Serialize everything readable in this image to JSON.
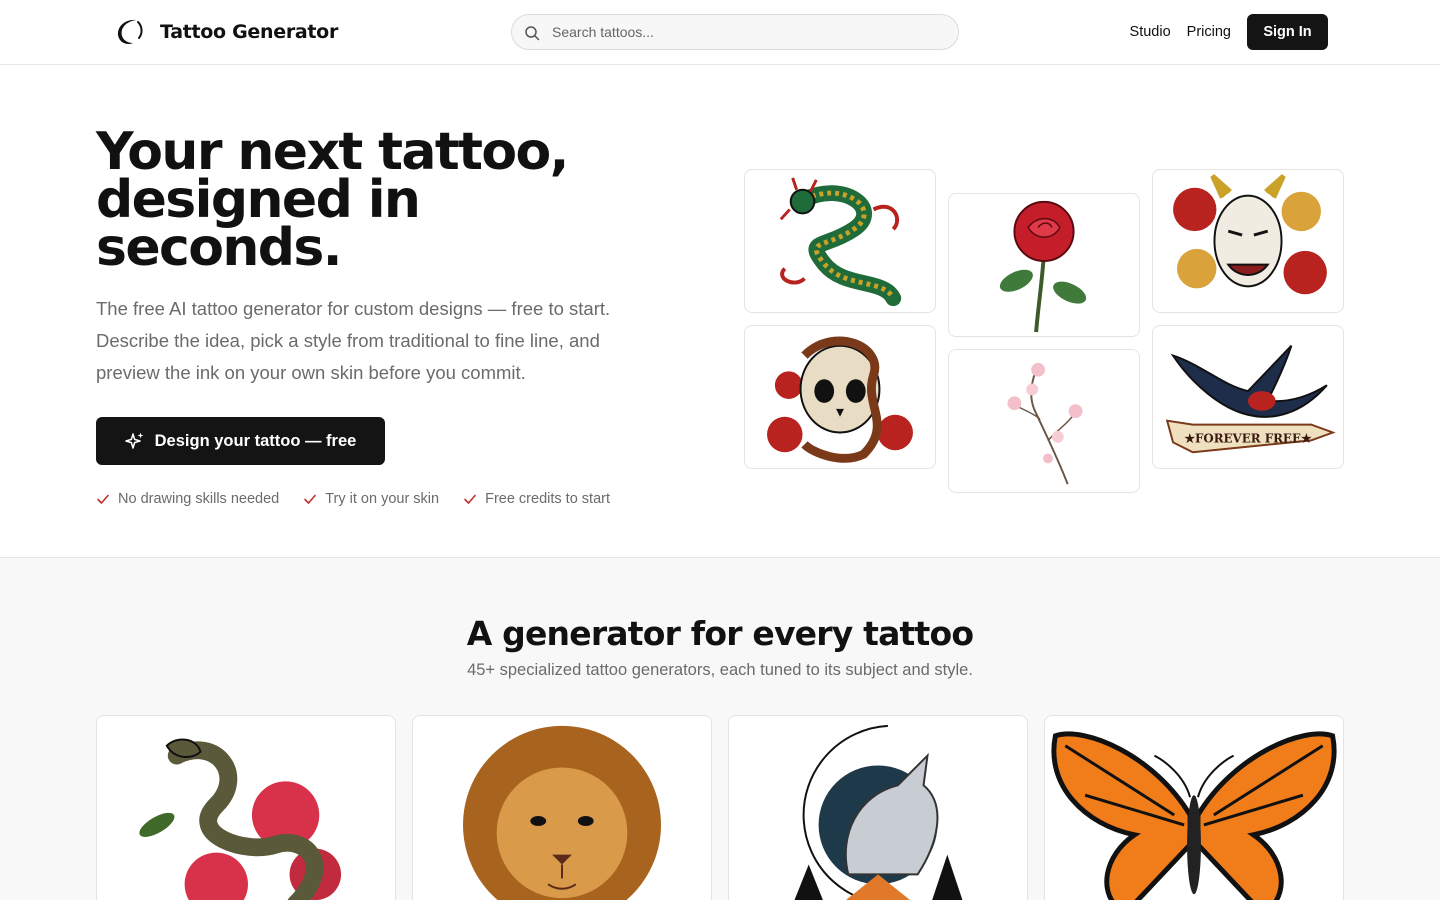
{
  "header": {
    "logo_text": "Tattoo Generator",
    "search_placeholder": "Search tattoos...",
    "nav": {
      "studio": "Studio",
      "pricing": "Pricing",
      "sign_in": "Sign In"
    }
  },
  "hero": {
    "title": "Your next tattoo, designed in seconds.",
    "description": "The free AI tattoo generator for custom designs — free to start. Describe the idea, pick a style from traditional to fine line, and preview the ink on your own skin before you commit.",
    "cta_label": "Design your tattoo — free",
    "checks": [
      "No drawing skills needed",
      "Try it on your skin",
      "Free credits to start"
    ],
    "gallery": [
      {
        "icon": "dragon-tattoo-image"
      },
      {
        "icon": "rose-tattoo-image"
      },
      {
        "icon": "hannya-mask-tattoo-image"
      },
      {
        "icon": "skull-snake-tattoo-image"
      },
      {
        "icon": "cherry-blossom-tattoo-image"
      },
      {
        "icon": "swallow-banner-tattoo-image",
        "banner_text": "★FOREVER FREE★"
      }
    ]
  },
  "generators": {
    "title": "A generator for every tattoo",
    "subtitle": "45+ specialized tattoo generators, each tuned to its subject and style.",
    "cards": [
      {
        "icon": "snake-peony-tattoo-image"
      },
      {
        "icon": "lion-tattoo-image"
      },
      {
        "icon": "wolf-moon-tattoo-image"
      },
      {
        "icon": "monarch-butterfly-tattoo-image"
      }
    ]
  },
  "colors": {
    "primary": "#141414",
    "muted_text": "#6b6b6b",
    "check_red": "#c0302a",
    "border": "#e4e4e4",
    "section_bg": "#f8f8f8"
  }
}
